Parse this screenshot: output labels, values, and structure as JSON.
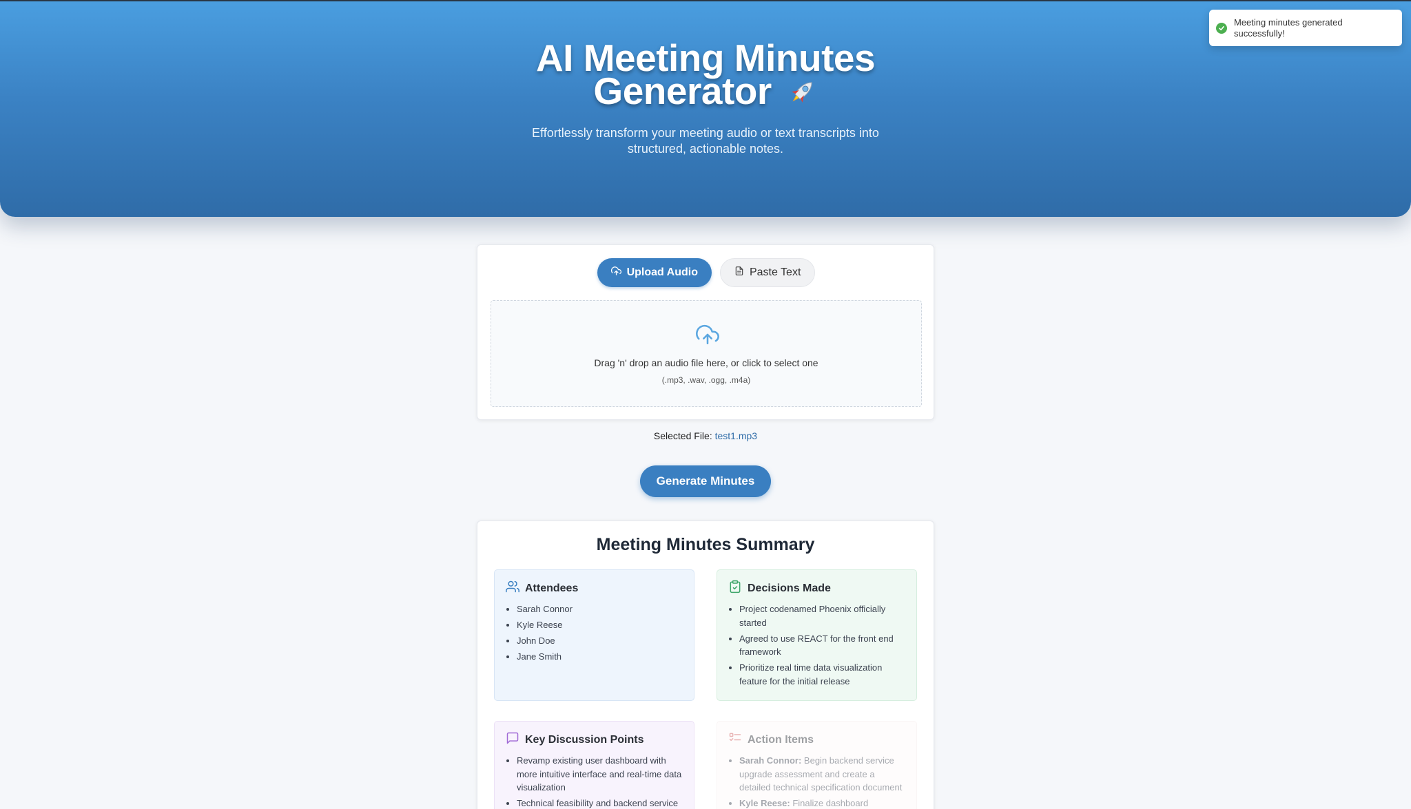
{
  "hero": {
    "title_line1": "AI Meeting Minutes",
    "title_line2": "Generator",
    "subtitle_line1": "Effortlessly transform your meeting audio or text transcripts into",
    "subtitle_line2": "structured, actionable notes."
  },
  "toast": {
    "line1": "Meeting minutes generated",
    "line2": "successfully!",
    "icon": "check-circle-icon",
    "color": "#4caf50"
  },
  "tabs": {
    "upload_label": "Upload Audio",
    "paste_label": "Paste Text",
    "active": "Upload Audio"
  },
  "dropzone": {
    "text": "Drag 'n' drop an audio file here, or click to select one",
    "hint": "(.mp3, .wav, .ogg, .m4a)"
  },
  "selected_file": {
    "label": "Selected File:",
    "name": "test1.mp3"
  },
  "generate_button": "Generate Minutes",
  "summary": {
    "title": "Meeting Minutes Summary",
    "attendees": {
      "heading": "Attendees",
      "items": [
        "Sarah Connor",
        "Kyle Reese",
        "John Doe",
        "Jane Smith"
      ]
    },
    "decisions": {
      "heading": "Decisions Made",
      "items": [
        "Project codenamed Phoenix officially started",
        "Agreed to use REACT for the front end framework",
        "Prioritize real time data visualization feature for the initial release"
      ]
    },
    "discussion": {
      "heading": "Key Discussion Points",
      "items": [
        "Revamp existing user dashboard with more intuitive interface and real-time data visualization",
        "Technical feasibility and backend service"
      ]
    },
    "actions": {
      "heading": "Action Items",
      "items": [
        {
          "owner": "Sarah Connor:",
          "task": "Begin backend service upgrade assessment and create a detailed technical specification document"
        },
        {
          "owner": "Kyle Reese:",
          "task": "Finalize dashboard mockups"
        }
      ]
    }
  },
  "colors": {
    "primary": "#3a7fc1",
    "hero_top": "#4a9ee0",
    "hero_bottom": "#2f6ca8",
    "attendees_bg": "#eef5fd",
    "decisions_bg": "#eff9f3",
    "discussion_bg": "#f8f3fd"
  }
}
